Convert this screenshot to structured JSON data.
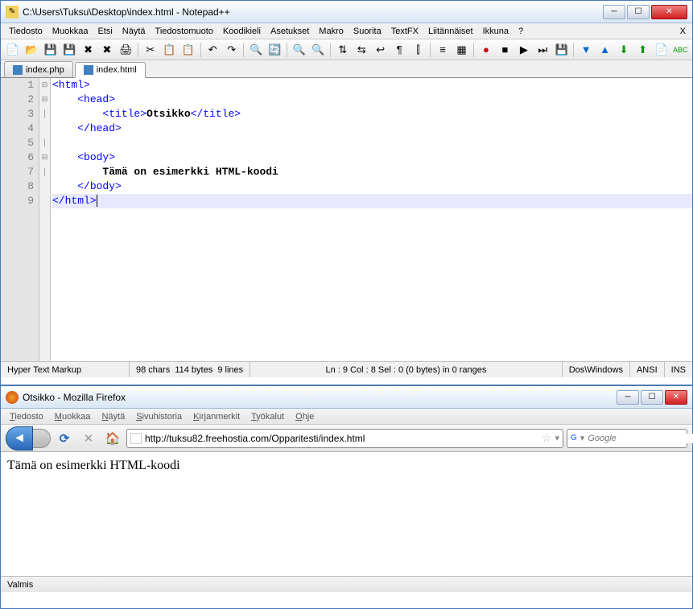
{
  "notepadpp": {
    "title": "C:\\Users\\Tuksu\\Desktop\\index.html - Notepad++",
    "menubar": [
      "Tiedosto",
      "Muokkaa",
      "Etsi",
      "Näytä",
      "Tiedostomuoto",
      "Koodikieli",
      "Asetukset",
      "Makro",
      "Suorita",
      "TextFX",
      "Liitännäiset",
      "Ikkuna",
      "?"
    ],
    "tabs": [
      {
        "label": "index.php",
        "active": false
      },
      {
        "label": "index.html",
        "active": true
      }
    ],
    "code": {
      "lines": [
        {
          "n": 1,
          "fold": "⊟",
          "segs": [
            {
              "t": "<html>",
              "c": "tag"
            }
          ]
        },
        {
          "n": 2,
          "fold": "⊟",
          "segs": [
            {
              "t": "    ",
              "c": ""
            },
            {
              "t": "<head>",
              "c": "tag"
            }
          ]
        },
        {
          "n": 3,
          "fold": "│",
          "segs": [
            {
              "t": "        ",
              "c": ""
            },
            {
              "t": "<title>",
              "c": "tag"
            },
            {
              "t": "Otsikko",
              "c": "text"
            },
            {
              "t": "</title>",
              "c": "tag"
            }
          ]
        },
        {
          "n": 4,
          "fold": "",
          "segs": [
            {
              "t": "    ",
              "c": ""
            },
            {
              "t": "</head>",
              "c": "tag"
            }
          ]
        },
        {
          "n": 5,
          "fold": "│",
          "segs": []
        },
        {
          "n": 6,
          "fold": "⊟",
          "segs": [
            {
              "t": "    ",
              "c": ""
            },
            {
              "t": "<body>",
              "c": "tag"
            }
          ]
        },
        {
          "n": 7,
          "fold": "│",
          "segs": [
            {
              "t": "        ",
              "c": ""
            },
            {
              "t": "Tämä on esimerkki HTML-koodi",
              "c": "text"
            }
          ]
        },
        {
          "n": 8,
          "fold": "",
          "segs": [
            {
              "t": "    ",
              "c": ""
            },
            {
              "t": "</body>",
              "c": "tag"
            }
          ]
        },
        {
          "n": 9,
          "fold": "",
          "current": true,
          "segs": [
            {
              "t": "</html>",
              "c": "tag"
            }
          ]
        }
      ]
    },
    "status": {
      "lang": "Hyper Text Markup",
      "chars": "98 chars",
      "bytes": "114 bytes",
      "lines": "9 lines",
      "pos": "Ln : 9   Col : 8   Sel : 0 (0 bytes) in 0 ranges",
      "eol": "Dos\\Windows",
      "enc": "ANSI",
      "mode": "INS"
    }
  },
  "firefox": {
    "title": "Otsikko - Mozilla Firefox",
    "menubar": [
      {
        "u": "T",
        "rest": "iedosto"
      },
      {
        "u": "M",
        "rest": "uokkaa"
      },
      {
        "u": "N",
        "rest": "äytä"
      },
      {
        "u": "S",
        "rest": "ivuhistoria"
      },
      {
        "u": "K",
        "rest": "irjanmerkit"
      },
      {
        "u": "T",
        "rest": "yökalut"
      },
      {
        "u": "O",
        "rest": "hje"
      }
    ],
    "url": "http://tuksu82.freehostia.com/Opparitesti/index.html",
    "search_placeholder": "Google",
    "content": "Tämä on esimerkki HTML-koodi",
    "status": "Valmis"
  }
}
